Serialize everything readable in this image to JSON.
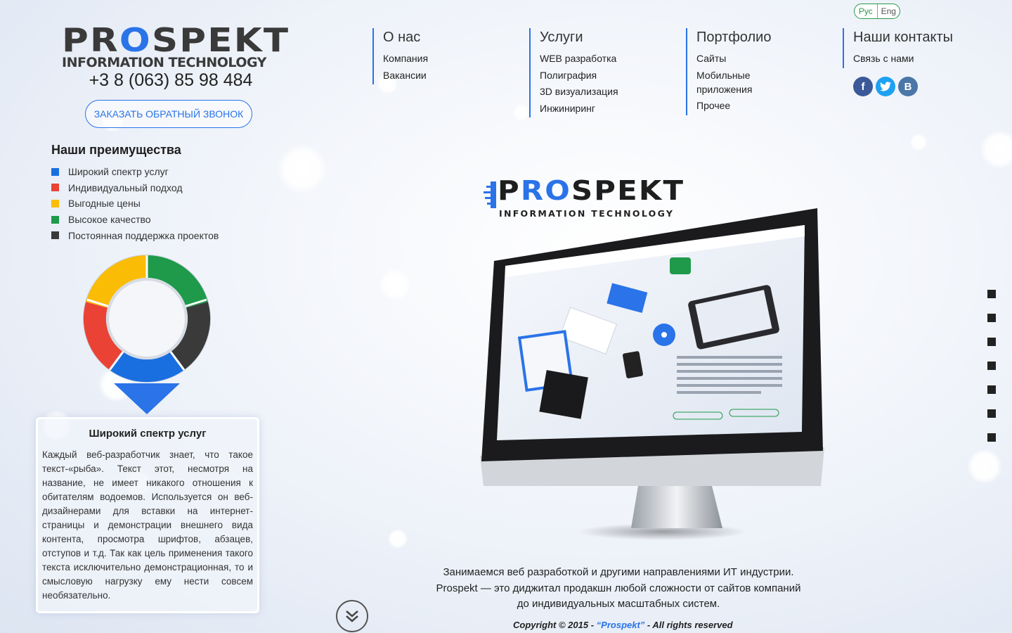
{
  "logo": {
    "main_pre": "PR",
    "main_o": "O",
    "main_post": "SPEKT",
    "sub": "INFORMATION TECHNOLOGY"
  },
  "phone": "+3 8 (063) 85 98 484",
  "callback_label": "ЗАКАЗАТЬ ОБРАТНЫЙ ЗВОНОК",
  "advantages": {
    "title": "Наши преимущества",
    "items": [
      {
        "label": "Широкий спектр услуг",
        "color": "#1a6fe0"
      },
      {
        "label": "Индивидуальный подход",
        "color": "#ea4335"
      },
      {
        "label": "Выгодные цены",
        "color": "#fbbc05"
      },
      {
        "label": "Высокое качество",
        "color": "#1e9a4a"
      },
      {
        "label": "Постоянная поддержка проектов",
        "color": "#3a3a3a"
      }
    ]
  },
  "desc": {
    "title": "Широкий спектр услуг",
    "text": "Каждый веб-разработчик знает, что такое текст-«рыба». Текст этот, несмотря на название, не имеет никакого отношения к обитателям водоемов. Используется он веб-дизайнерами для вставки на интернет-страницы и демонстрации внешнего вида контента, просмотра шрифтов, абзацев, отступов и т.д. Так как цель применения такого текста исключительно демонстрационная, то и смысловую нагрузку ему нести совсем необязательно."
  },
  "lang": {
    "ru": "Рус",
    "en": "Eng"
  },
  "nav": [
    {
      "head": "О нас",
      "items": [
        "Компания",
        "Вакансии"
      ]
    },
    {
      "head": "Услуги",
      "items": [
        "WEB разработка",
        "Полиграфия",
        "3D визуализация",
        "Инжиниринг"
      ]
    },
    {
      "head": "Портфолио",
      "items": [
        "Сайты",
        "Мобильные приложения",
        "Прочее"
      ]
    },
    {
      "head": "Наши контакты",
      "items": [
        "Связь с нами"
      ]
    }
  ],
  "social": {
    "facebook": "f",
    "vk": "B"
  },
  "hero_logo": {
    "main_pre": "P",
    "main_o": "RO",
    "main_post": "SPEKT",
    "sub": "INFORMATION TECHNOLOGY"
  },
  "tagline": [
    "Занимаемся веб разработкой и другими направлениями ИТ индустрии.",
    "Prospekt — это диджитал продакшн любой сложности от сайтов компаний",
    "до индивидуальных масштабных систем."
  ],
  "copyright": {
    "prefix": "Copyright © 2015 - ",
    "brand": "“Prospekt”",
    "suffix": " - All rights reserved"
  },
  "colors": {
    "accent": "#2a73e8",
    "lang_green": "#2a9a4a",
    "facebook": "#3b5998",
    "twitter": "#1da1f2",
    "vk": "#4a76a8"
  }
}
